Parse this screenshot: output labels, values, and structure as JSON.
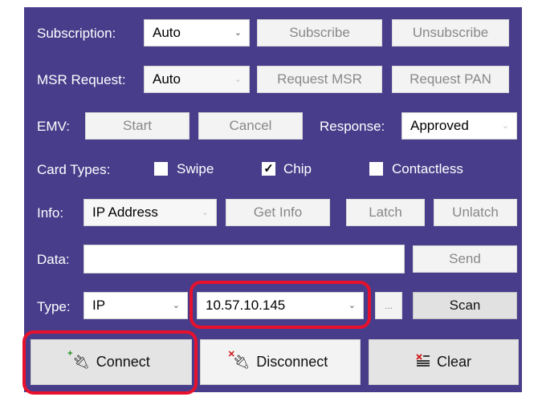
{
  "subscription": {
    "label": "Subscription:",
    "value": "Auto",
    "subscribe": "Subscribe",
    "unsubscribe": "Unsubscribe"
  },
  "msr": {
    "label": "MSR Request:",
    "value": "Auto",
    "request_msr": "Request MSR",
    "request_pan": "Request PAN"
  },
  "emv": {
    "label": "EMV:",
    "start": "Start",
    "cancel": "Cancel",
    "response_label": "Response:",
    "response_value": "Approved"
  },
  "card_types": {
    "label": "Card Types:",
    "swipe": {
      "label": "Swipe",
      "checked": false
    },
    "chip": {
      "label": "Chip",
      "checked": true,
      "mark": "✓"
    },
    "contactless": {
      "label": "Contactless",
      "checked": false
    }
  },
  "info": {
    "label": "Info:",
    "value": "IP Address",
    "get_info": "Get Info",
    "latch": "Latch",
    "unlatch": "Unlatch"
  },
  "data_row": {
    "label": "Data:",
    "value": "",
    "send": "Send"
  },
  "type_row": {
    "label": "Type:",
    "type_value": "IP",
    "address_value": "10.57.10.145",
    "more": "...",
    "scan": "Scan"
  },
  "actions": {
    "connect": "Connect",
    "disconnect": "Disconnect",
    "clear": "Clear"
  },
  "colors": {
    "panel": "#483d8b",
    "highlight": "#e8112d"
  },
  "icons": {
    "connect": "plug-add-icon",
    "disconnect": "plug-remove-icon",
    "clear": "clear-list-icon",
    "dropdown": "chevron-down-icon"
  }
}
